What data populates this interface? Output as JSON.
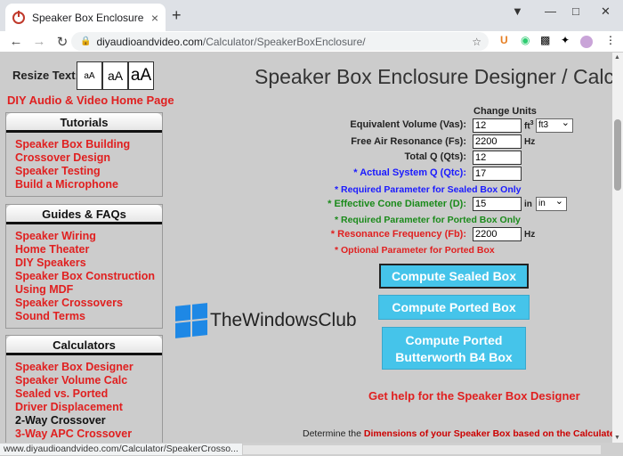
{
  "browser": {
    "tab_title": "Speaker Box Enclosure Designer",
    "tab_close": "×",
    "new_tab": "+",
    "url_domain": "diyaudioandvideo.com",
    "url_path": "/Calculator/SpeakerBoxEnclosure/",
    "status_url": "www.diyaudioandvideo.com/Calculator/SpeakerCrosso..."
  },
  "sidebar": {
    "resize_label": "Resize Text:",
    "resize_options": [
      "aA",
      "aA",
      "aA"
    ],
    "home_link": "DIY Audio & Video Home Page",
    "tutorials": {
      "title": "Tutorials",
      "items": [
        "Speaker Box Building",
        "Crossover Design",
        "Speaker Testing",
        "Build a Microphone"
      ]
    },
    "guides": {
      "title": "Guides & FAQs",
      "items": [
        "Speaker Wiring",
        "Home Theater",
        "DIY Speakers",
        "Speaker Box Construction",
        "Using MDF",
        "Speaker Crossovers",
        "Sound Terms"
      ]
    },
    "calculators": {
      "title": "Calculators",
      "items": [
        "Speaker Box Designer",
        "Speaker Volume Calc",
        "Sealed vs. Ported",
        "Driver Displacement",
        "2-Way Crossover",
        "3-Way APC Crossover"
      ]
    }
  },
  "main": {
    "heading": "Speaker Box Enclosure Designer / Calcu",
    "change_units": "Change Units",
    "fields": {
      "vas": {
        "label": "Equivalent Volume (Vas):",
        "value": "12",
        "unit": "ft",
        "unit_sup": "3",
        "select": "ft3"
      },
      "fs": {
        "label": "Free Air Resonance (Fs):",
        "value": "2200",
        "unit": "Hz"
      },
      "qts": {
        "label": "Total Q (Qts):",
        "value": "12"
      },
      "qtc": {
        "label": "* Actual System Q (Qtc):",
        "value": "17"
      },
      "d": {
        "label": "* Effective Cone Diameter (D):",
        "value": "15",
        "unit": "in",
        "select": "in"
      },
      "fb": {
        "label": "* Resonance Frequency (Fb):",
        "value": "2200",
        "unit": "Hz"
      }
    },
    "notes": {
      "sealed": "* Required Parameter for Sealed Box Only",
      "ported": "* Required Parameter for Ported Box Only",
      "optional": "* Optional Parameter for Ported Box"
    },
    "buttons": {
      "sealed": "Compute Sealed Box",
      "ported": "Compute Ported Box",
      "b4_line1": "Compute Ported",
      "b4_line2": "Butterworth B4 Box"
    },
    "help_link": "Get help for the Speaker Box Designer",
    "determine_prefix": "Determine the",
    "determine_red": "Dimensions of your Speaker Box based on the Calculate"
  },
  "watermark": "TheWindowsClub",
  "colors": {
    "link_red": "#e02020",
    "note_blue": "#1a1aff",
    "note_green": "#1a8a1a",
    "button_blue": "#45c4ea"
  }
}
